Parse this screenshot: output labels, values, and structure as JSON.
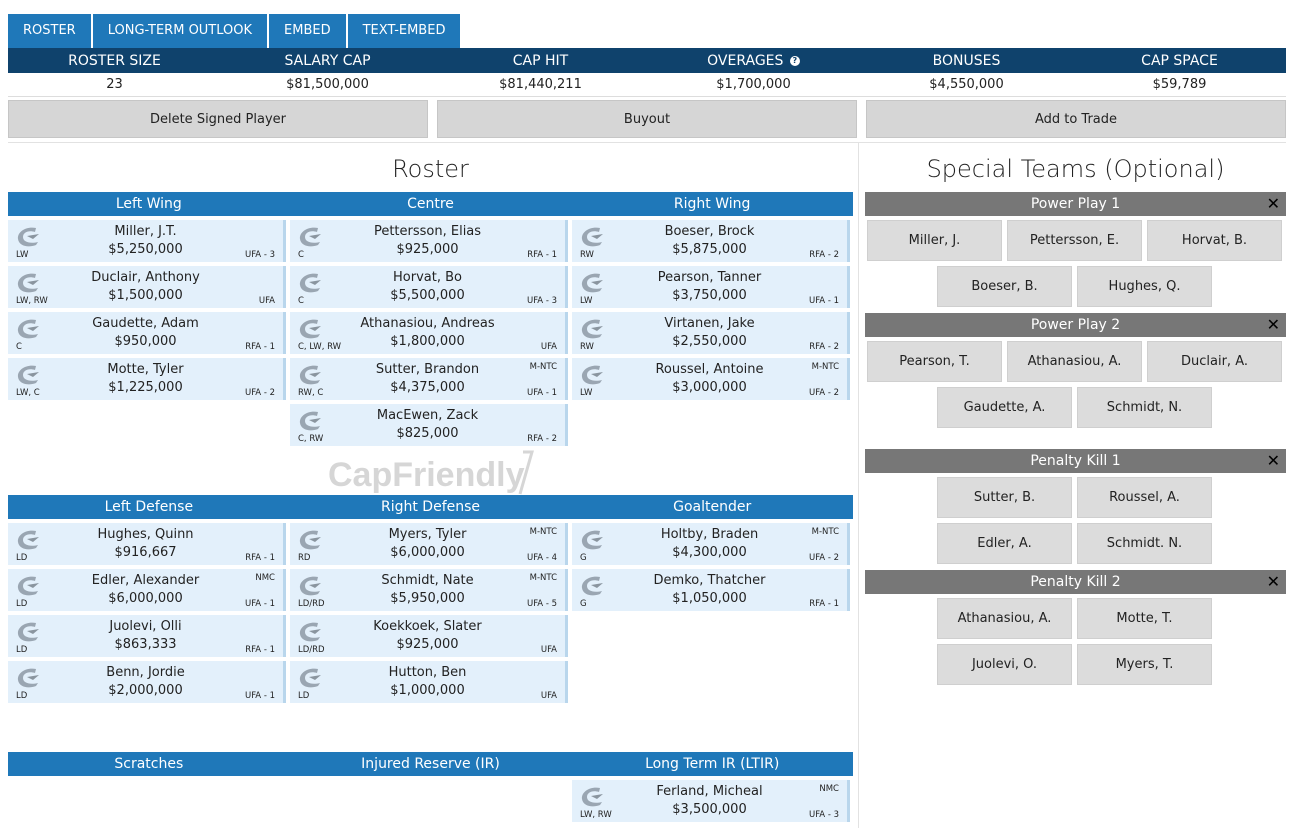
{
  "tabs": [
    "ROSTER",
    "LONG-TERM OUTLOOK",
    "EMBED",
    "TEXT-EMBED"
  ],
  "summary": {
    "headers": [
      "ROSTER SIZE",
      "SALARY CAP",
      "CAP HIT",
      "OVERAGES",
      "BONUSES",
      "CAP SPACE"
    ],
    "help_icon": "?",
    "values": [
      "23",
      "$81,500,000",
      "$81,440,211",
      "$1,700,000",
      "$4,550,000",
      "$59,789"
    ]
  },
  "actions": [
    "Delete Signed Player",
    "Buyout",
    "Add to Trade"
  ],
  "roster": {
    "title": "Roster",
    "forward_headers": [
      "Left Wing",
      "Centre",
      "Right Wing"
    ],
    "defense_headers": [
      "Left Defense",
      "Right Defense",
      "Goaltender"
    ],
    "reserve_headers": [
      "Scratches",
      "Injured Reserve (IR)",
      "Long Term IR (LTIR)"
    ],
    "left_wing": [
      {
        "name": "Miller, J.T.",
        "salary": "$5,250,000",
        "pos": "LW",
        "status": "UFA - 3",
        "clause": ""
      },
      {
        "name": "Duclair, Anthony",
        "salary": "$1,500,000",
        "pos": "LW, RW",
        "status": "UFA",
        "clause": ""
      },
      {
        "name": "Gaudette, Adam",
        "salary": "$950,000",
        "pos": "C",
        "status": "RFA - 1",
        "clause": ""
      },
      {
        "name": "Motte, Tyler",
        "salary": "$1,225,000",
        "pos": "LW, C",
        "status": "UFA - 2",
        "clause": ""
      }
    ],
    "centre": [
      {
        "name": "Pettersson, Elias",
        "salary": "$925,000",
        "pos": "C",
        "status": "RFA - 1",
        "clause": ""
      },
      {
        "name": "Horvat, Bo",
        "salary": "$5,500,000",
        "pos": "C",
        "status": "UFA - 3",
        "clause": ""
      },
      {
        "name": "Athanasiou, Andreas",
        "salary": "$1,800,000",
        "pos": "C, LW, RW",
        "status": "UFA",
        "clause": ""
      },
      {
        "name": "Sutter, Brandon",
        "salary": "$4,375,000",
        "pos": "RW, C",
        "status": "UFA - 1",
        "clause": "M-NTC"
      },
      {
        "name": "MacEwen, Zack",
        "salary": "$825,000",
        "pos": "C, RW",
        "status": "RFA - 2",
        "clause": ""
      }
    ],
    "right_wing": [
      {
        "name": "Boeser, Brock",
        "salary": "$5,875,000",
        "pos": "RW",
        "status": "RFA - 2",
        "clause": ""
      },
      {
        "name": "Pearson, Tanner",
        "salary": "$3,750,000",
        "pos": "LW",
        "status": "UFA - 1",
        "clause": ""
      },
      {
        "name": "Virtanen, Jake",
        "salary": "$2,550,000",
        "pos": "RW",
        "status": "RFA - 2",
        "clause": ""
      },
      {
        "name": "Roussel, Antoine",
        "salary": "$3,000,000",
        "pos": "LW",
        "status": "UFA - 2",
        "clause": "M-NTC"
      }
    ],
    "left_defense": [
      {
        "name": "Hughes, Quinn",
        "salary": "$916,667",
        "pos": "LD",
        "status": "RFA - 1",
        "clause": ""
      },
      {
        "name": "Edler, Alexander",
        "salary": "$6,000,000",
        "pos": "LD",
        "status": "UFA - 1",
        "clause": "NMC"
      },
      {
        "name": "Juolevi, Olli",
        "salary": "$863,333",
        "pos": "LD",
        "status": "RFA - 1",
        "clause": ""
      },
      {
        "name": "Benn, Jordie",
        "salary": "$2,000,000",
        "pos": "LD",
        "status": "UFA - 1",
        "clause": ""
      }
    ],
    "right_defense": [
      {
        "name": "Myers, Tyler",
        "salary": "$6,000,000",
        "pos": "RD",
        "status": "UFA - 4",
        "clause": "M-NTC"
      },
      {
        "name": "Schmidt, Nate",
        "salary": "$5,950,000",
        "pos": "LD/RD",
        "status": "UFA - 5",
        "clause": "M-NTC"
      },
      {
        "name": "Koekkoek, Slater",
        "salary": "$925,000",
        "pos": "LD/RD",
        "status": "UFA",
        "clause": ""
      },
      {
        "name": "Hutton, Ben",
        "salary": "$1,000,000",
        "pos": "LD",
        "status": "UFA",
        "clause": ""
      }
    ],
    "goaltender": [
      {
        "name": "Holtby, Braden",
        "salary": "$4,300,000",
        "pos": "G",
        "status": "UFA - 2",
        "clause": "M-NTC"
      },
      {
        "name": "Demko, Thatcher",
        "salary": "$1,050,000",
        "pos": "G",
        "status": "RFA - 1",
        "clause": ""
      }
    ],
    "ltir": [
      {
        "name": "Ferland, Micheal",
        "salary": "$3,500,000",
        "pos": "LW, RW",
        "status": "UFA - 3",
        "clause": "NMC"
      }
    ]
  },
  "special_teams": {
    "title": "Special Teams (Optional)",
    "close_icon": "✕",
    "units": [
      {
        "name": "Power Play 1",
        "players": [
          "Miller, J.",
          "Pettersson, E.",
          "Horvat, B.",
          "Boeser, B.",
          "Hughes, Q."
        ]
      },
      {
        "name": "Power Play 2",
        "players": [
          "Pearson, T.",
          "Athanasiou, A.",
          "Duclair, A.",
          "Gaudette, A.",
          "Schmidt, N."
        ]
      },
      {
        "name": "Penalty Kill 1",
        "players": [
          "Sutter, B.",
          "Roussel, A.",
          "Edler, A.",
          "Schmidt. N."
        ]
      },
      {
        "name": "Penalty Kill 2",
        "players": [
          "Athanasiou, A.",
          "Motte, T.",
          "Juolevi, O.",
          "Myers, T."
        ]
      }
    ]
  },
  "watermark": "CapFriendly",
  "colors": {
    "tab_blue": "#1f78b9",
    "header_navy": "#0f426c",
    "card_bg": "#e3f0fb",
    "st_bar": "#777777"
  }
}
